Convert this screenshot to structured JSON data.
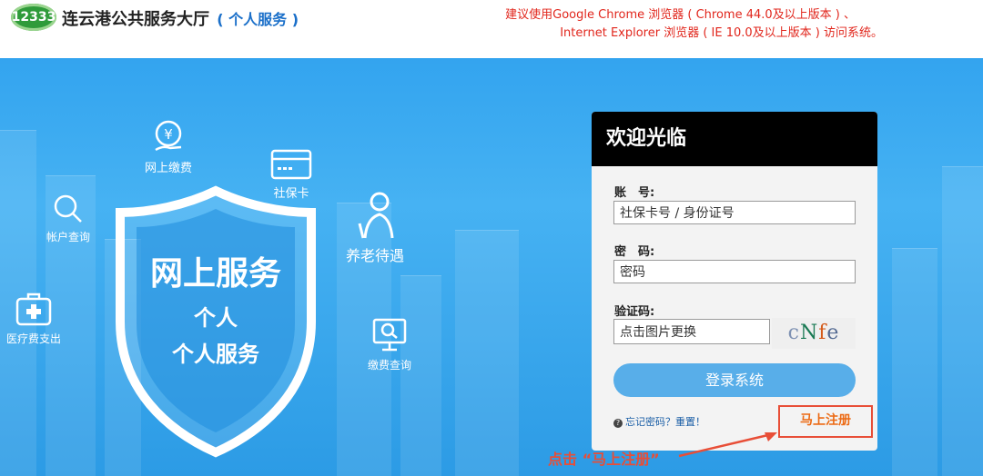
{
  "header": {
    "logo_text": "12333",
    "title": "连云港公共服务大厅",
    "title_sub": "( 个人服务 )",
    "notice_line1": "建议使用Google Chrome 浏览器 ( Chrome 44.0及以上版本 ) 、",
    "notice_line2": "Internet Explorer 浏览器 ( IE 10.0及以上版本 ) 访问系统。"
  },
  "services": {
    "items": [
      {
        "label": "网上缴费",
        "icon": "yen-hand-icon"
      },
      {
        "label": "社保卡",
        "icon": "card-icon"
      },
      {
        "label": "帐户查询",
        "icon": "search-icon"
      },
      {
        "label": "养老待遇",
        "icon": "elder-icon"
      },
      {
        "label": "医疗费支出",
        "icon": "medical-kit-icon"
      },
      {
        "label": "缴费查询",
        "icon": "monitor-search-icon"
      }
    ]
  },
  "shield": {
    "line1": "网上服务",
    "line2": "个人",
    "line3": "个人服务"
  },
  "login": {
    "title": "欢迎光临",
    "account_label": "账　号:",
    "account_placeholder": "社保卡号 / 身份证号",
    "password_label": "密　码:",
    "password_placeholder": "密码",
    "captcha_label": "验证码:",
    "captcha_placeholder": "点击图片更换",
    "captcha_chars": [
      "c",
      "N",
      "f",
      "e"
    ],
    "login_button": "登录系统",
    "forgot_text": "忘记密码？重置！",
    "register_button": "马上注册"
  },
  "annotation": {
    "text": "点击 “马上注册”"
  },
  "colors": {
    "banner": "#3aa8f0",
    "notice": "#e1261c",
    "annotation": "#e84e37",
    "register": "#ec6a14",
    "login_button": "#58aee9"
  }
}
